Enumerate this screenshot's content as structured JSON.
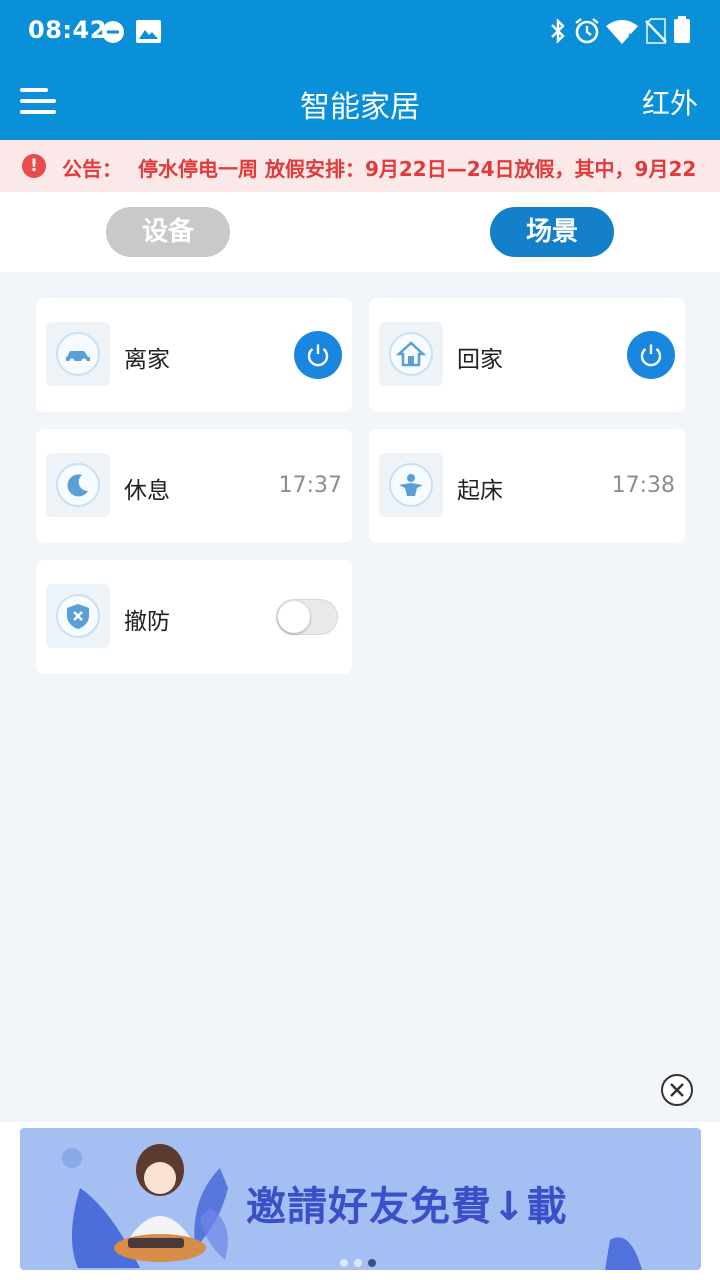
{
  "status_bar": {
    "time": "08:42",
    "left_icons": [
      "dnd-icon",
      "image-icon"
    ],
    "right_icons": [
      "bluetooth-icon",
      "alarm-icon",
      "wifi-icon",
      "no-sim-icon",
      "battery-icon"
    ]
  },
  "app_bar": {
    "menu_icon": "menu-icon",
    "title": "智能家居",
    "right_action": "红外"
  },
  "notice": {
    "icon": "alert-icon",
    "label": "公告：",
    "text": "停水停电一周   放假安排：9月22日—24日放假，其中，9月22"
  },
  "tabs": {
    "devices": "设备",
    "scenes": "场景",
    "active": "scenes"
  },
  "scenes": {
    "leave_home": {
      "name": "离家",
      "icon": "car-icon",
      "control": "power-button"
    },
    "back_home": {
      "name": "回家",
      "icon": "home-icon",
      "control": "power-button"
    },
    "rest": {
      "name": "休息",
      "icon": "moon-icon",
      "time": "17:37"
    },
    "wake_up": {
      "name": "起床",
      "icon": "wakeup-icon",
      "time": "17:38"
    },
    "disarm": {
      "name": "撤防",
      "icon": "shield-icon",
      "toggle_on": false
    }
  },
  "ad": {
    "text": "邀請好友免費↓載",
    "close_icon": "close-icon",
    "dots": 3,
    "active_dot": 3
  },
  "colors": {
    "primary": "#0a8fd9",
    "tab_active": "#1380c9",
    "tab_inactive": "#c9c9c9",
    "power": "#1a86e0",
    "notice_text": "#e23a3a",
    "background": "#f2f5f9"
  }
}
